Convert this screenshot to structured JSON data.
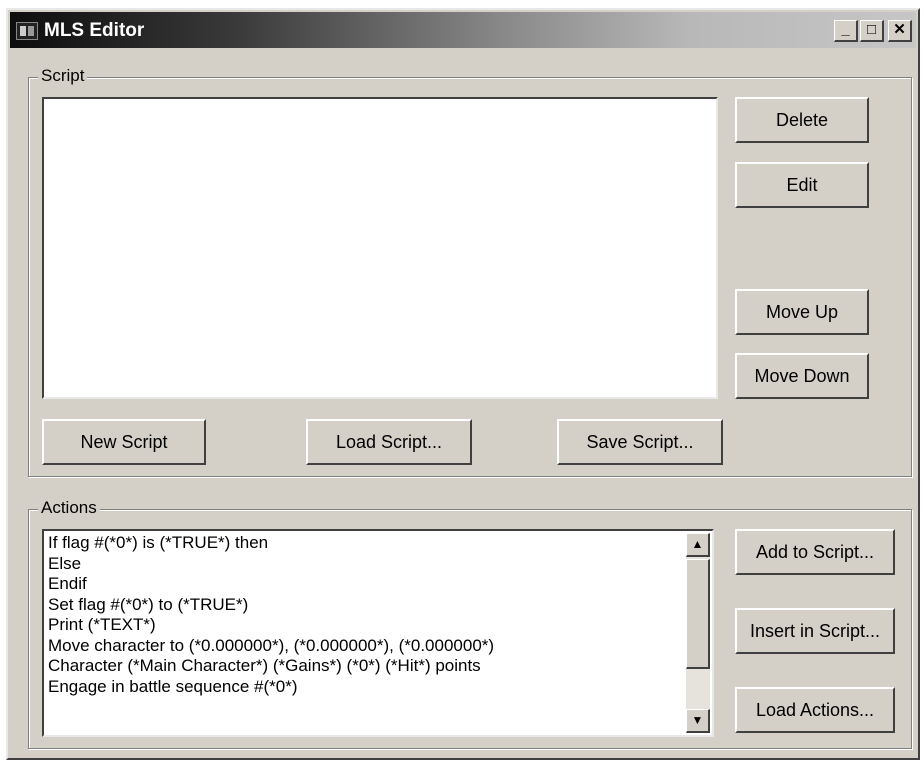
{
  "window": {
    "title": "MLS Editor",
    "controls": {
      "minimize": "_",
      "maximize": "□",
      "close": "✕"
    },
    "app_icon": "app-icon"
  },
  "script_group": {
    "label": "Script",
    "items": [],
    "buttons": {
      "delete": "Delete",
      "edit": "Edit",
      "move_up": "Move Up",
      "move_down": "Move Down",
      "new_script": "New Script",
      "load_script": "Load Script...",
      "save_script": "Save Script..."
    }
  },
  "actions_group": {
    "label": "Actions",
    "items": [
      "If flag #(*0*) is (*TRUE*) then",
      "Else",
      "Endif",
      "Set flag #(*0*) to (*TRUE*)",
      "Print (*TEXT*)",
      "Move character to (*0.000000*), (*0.000000*), (*0.000000*)",
      "Character (*Main Character*) (*Gains*) (*0*) (*Hit*) points",
      "Engage in battle sequence #(*0*)"
    ],
    "scrollbar": {
      "up_icon": "arrow-up-icon",
      "down_icon": "arrow-down-icon"
    },
    "buttons": {
      "add_to_script": "Add to Script...",
      "insert_in_script": "Insert in Script...",
      "load_actions": "Load Actions..."
    }
  }
}
